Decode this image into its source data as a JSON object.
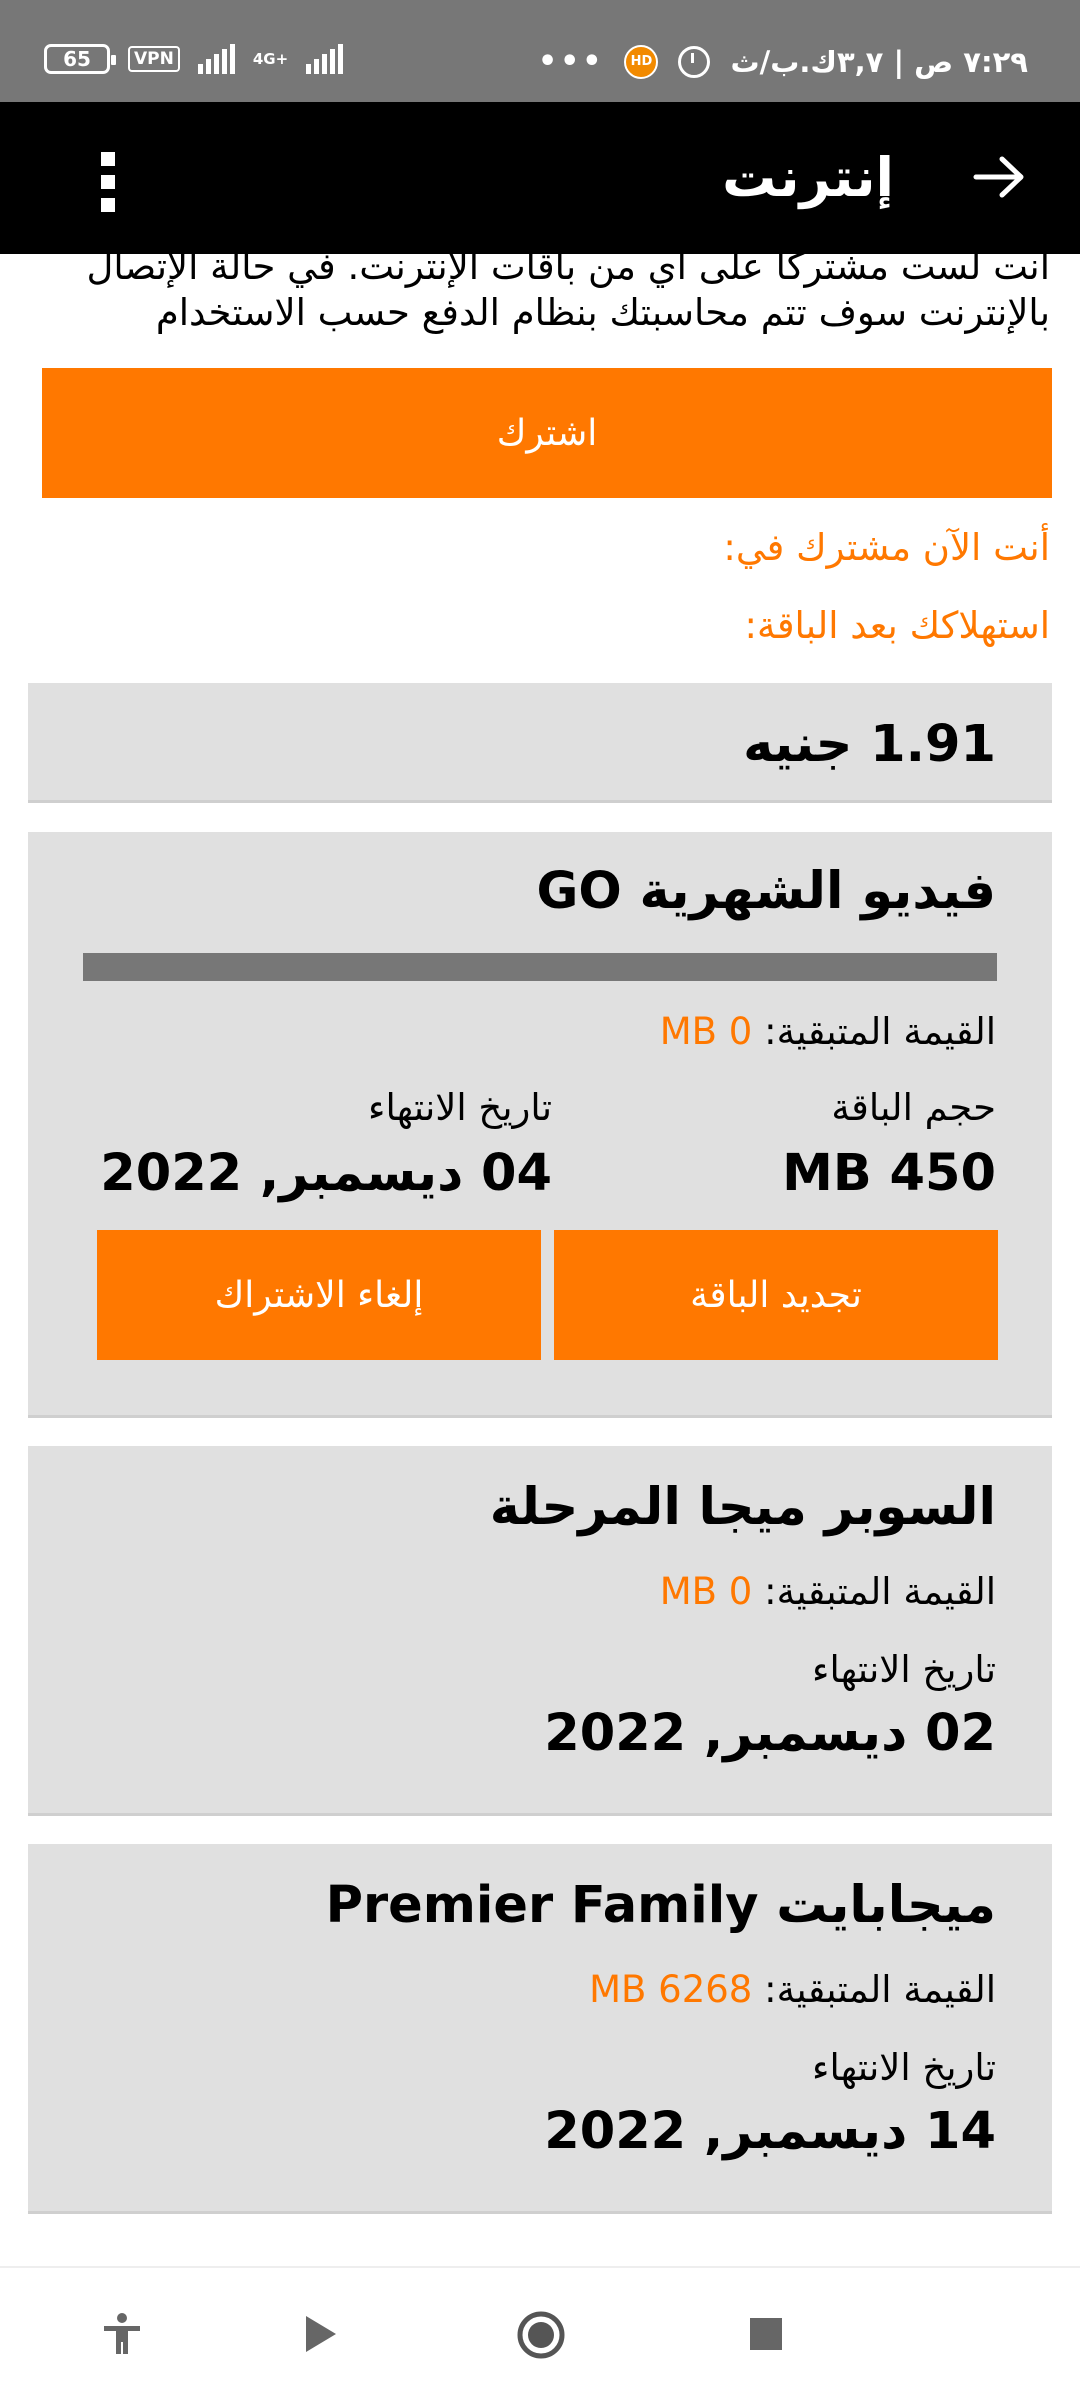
{
  "status_bar": {
    "time": "٧:٢٩ ص | ٣,٧ك.ب/ث",
    "battery": "65",
    "vpn": "VPN",
    "network": "4G+",
    "more": "•••"
  },
  "app_bar": {
    "title": "إنترنت",
    "back_icon": "arrow-right-icon",
    "menu_icon": "more-vert-icon"
  },
  "intro_text": "أنت لست مشتركا على أي من باقات الإنترنت. في حالة الإتصال بالإنترنت سوف تتم محاسبتك بنظام الدفع حسب الاستخدام",
  "subscribe_button": "اشترك",
  "subscribed_label": "أنت الآن مشترك في:",
  "usage_label": "استهلاكك بعد الباقة:",
  "balance": "1.91 جنيه",
  "packages": [
    {
      "title": "فيديو الشهرية GO",
      "progress_remaining": 0,
      "remaining_label": "القيمة المتبقية:",
      "remaining_value": "0 MB",
      "size_label": "حجم الباقة",
      "size_value": "450 MB",
      "expiry_label": "تاريخ الانتهاء",
      "expiry_value": "04 ديسمبر, 2022",
      "renew_button": "تجديد الباقة",
      "cancel_button": "إلغاء الاشتراك"
    },
    {
      "title": "السوبر ميجا المرحلة",
      "remaining_label": "القيمة المتبقية:",
      "remaining_value": "0 MB",
      "expiry_label": "تاريخ الانتهاء",
      "expiry_value": "02 ديسمبر, 2022"
    },
    {
      "title": "ميجابايت Premier Family",
      "remaining_label": "القيمة المتبقية:",
      "remaining_value": "6268 MB",
      "expiry_label": "تاريخ الانتهاء",
      "expiry_value": "14 ديسمبر, 2022"
    }
  ],
  "colors": {
    "accent": "#ff7800",
    "card": "#e0e0e0",
    "appbar": "#000000",
    "statusbar": "#777777"
  },
  "bottom_nav": [
    "accessibility-icon",
    "play-icon",
    "record-icon",
    "stop-icon"
  ]
}
